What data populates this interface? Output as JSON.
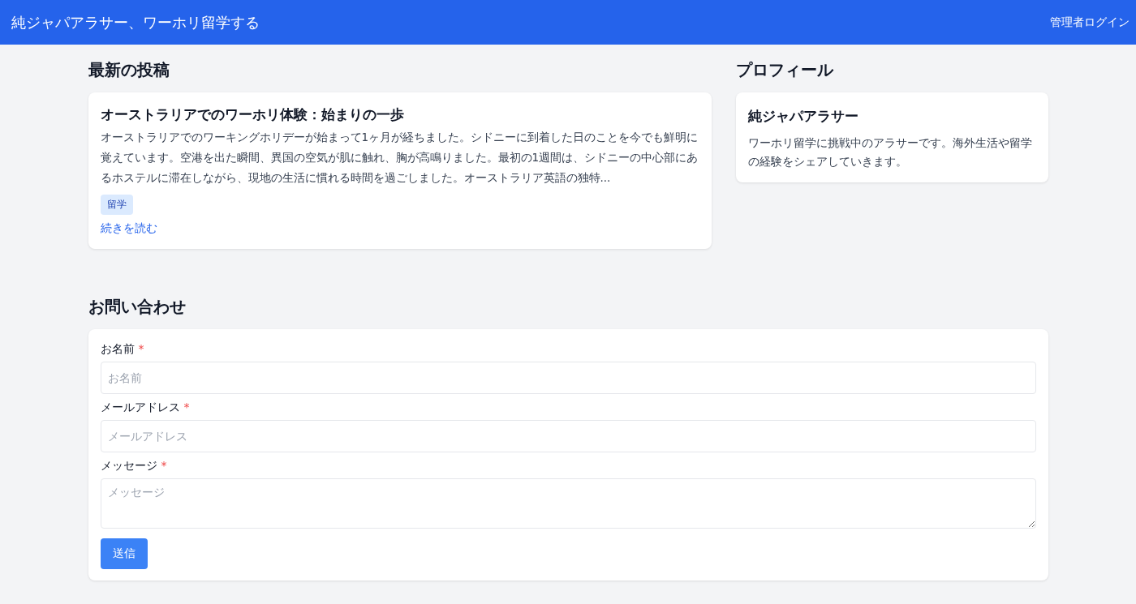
{
  "header": {
    "site_title": "純ジャパアラサー、ワーホリ留学する",
    "admin_link": "管理者ログイン"
  },
  "latest_posts": {
    "heading": "最新の投稿",
    "posts": [
      {
        "title": "オーストラリアでのワーホリ体験：始まりの一歩",
        "excerpt": "オーストラリアでのワーキングホリデーが始まって1ヶ月が経ちました。シドニーに到着した日のことを今でも鮮明に覚えています。空港を出た瞬間、異国の空気が肌に触れ、胸が高鳴りました。最初の1週間は、シドニーの中心部にあるホステルに滞在しながら、現地の生活に慣れる時間を過ごしました。オーストラリア英語の独特...",
        "tags": [
          "留学"
        ],
        "read_more": "続きを読む"
      }
    ]
  },
  "profile": {
    "heading": "プロフィール",
    "name": "純ジャパアラサー",
    "bio": "ワーホリ留学に挑戦中のアラサーです。海外生活や留学の経験をシェアしていきます。"
  },
  "contact": {
    "heading": "お問い合わせ",
    "fields": [
      {
        "kind": "input",
        "label": "お名前",
        "required_mark": "*",
        "placeholder": "お名前"
      },
      {
        "kind": "input",
        "label": "メールアドレス",
        "required_mark": "*",
        "placeholder": "メールアドレス"
      },
      {
        "kind": "textarea",
        "label": "メッセージ",
        "required_mark": "*",
        "placeholder": "メッセージ"
      }
    ],
    "submit": "送信"
  }
}
